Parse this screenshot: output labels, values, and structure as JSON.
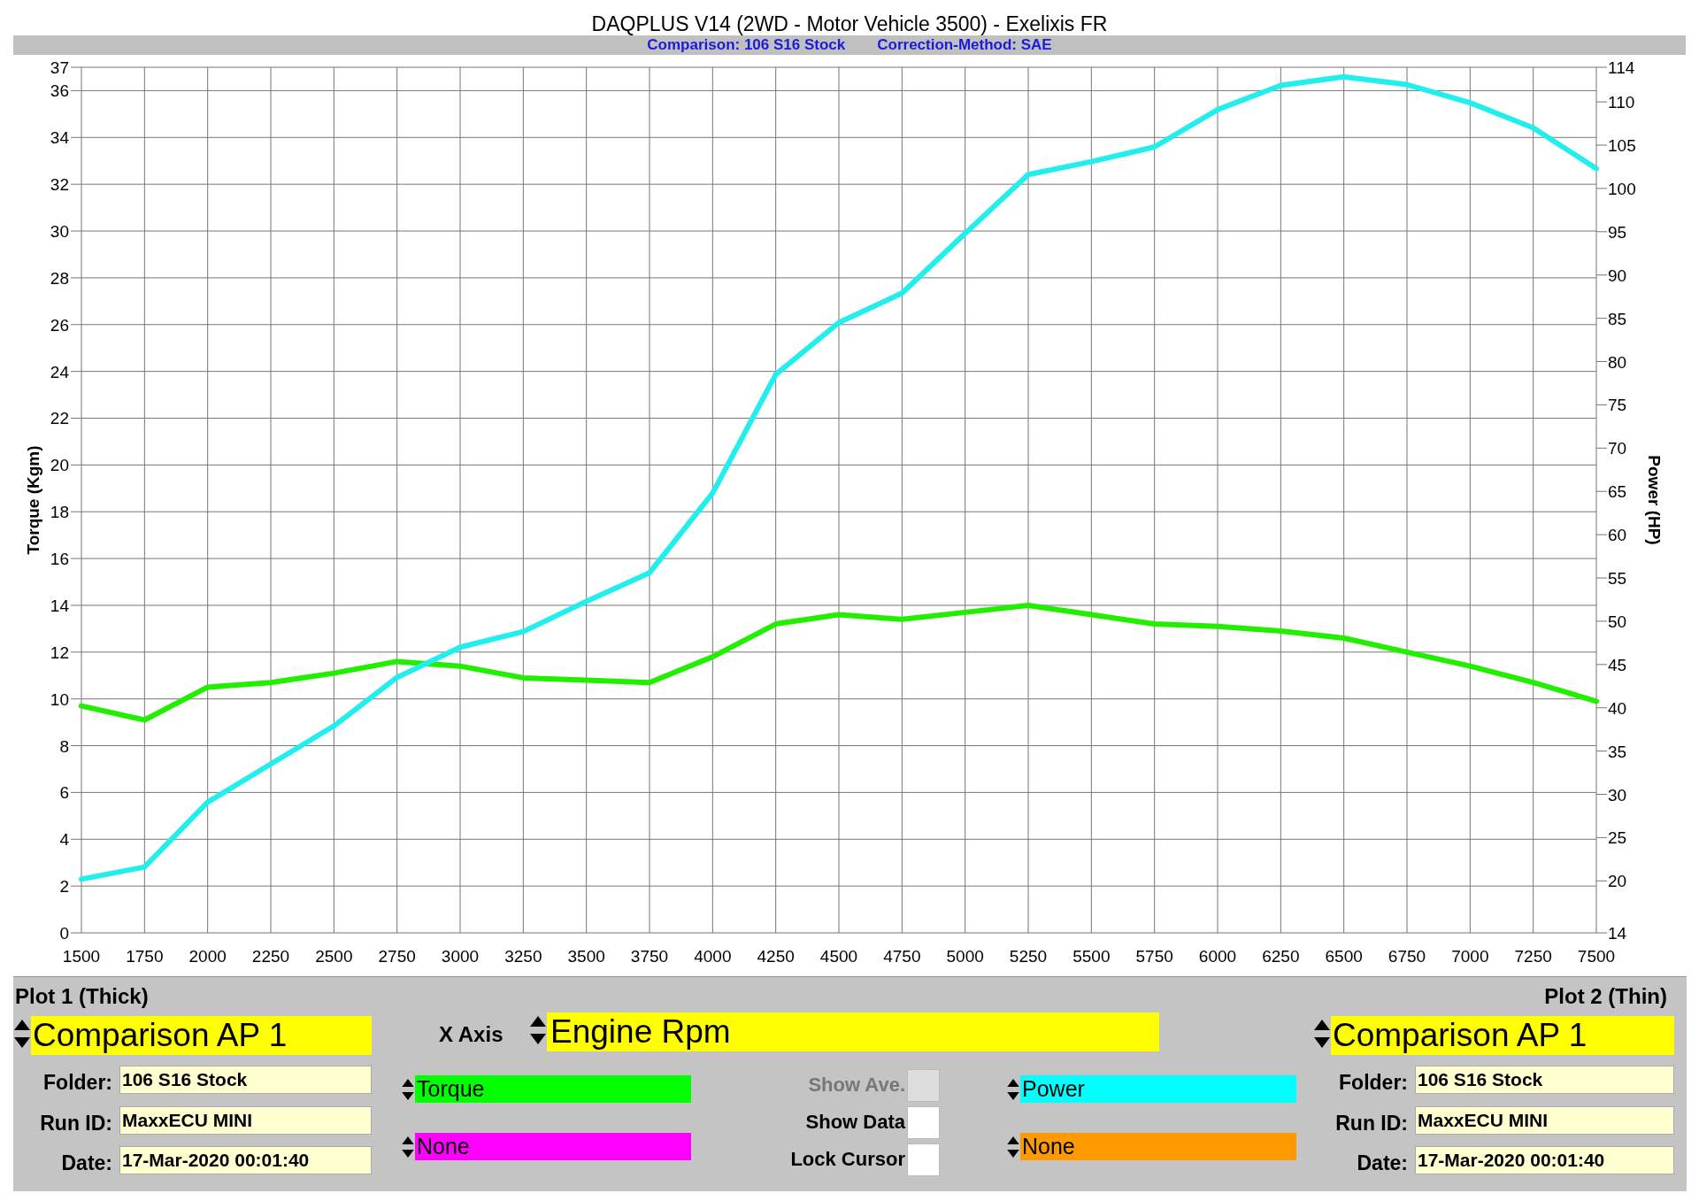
{
  "title": "DAQPLUS V14 (2WD - Motor Vehicle 3500) - Exelixis FR",
  "subtitle": [
    "Comparison: 106 S16 Stock",
    "Correction-Method: SAE"
  ],
  "torque_chart": {
    "chart_data": {
      "type": "line",
      "ylabel": "Torque (Kgm)",
      "grid": true,
      "categories": [
        "1500",
        "1750",
        "2000",
        "2250",
        "2500",
        "2750",
        "3000",
        "3250",
        "3500",
        "3750",
        "4000",
        "4250",
        "4500",
        "4750",
        "5000",
        "5250",
        "5500",
        "5750",
        "6000",
        "6250",
        "6500",
        "6750",
        "7000",
        "7250",
        "7500"
      ],
      "ylim": [
        0,
        37
      ],
      "yticks": [
        0,
        2,
        4,
        6,
        8,
        10,
        12,
        14,
        16,
        18,
        20,
        22,
        24,
        26,
        28,
        30,
        32,
        34,
        36,
        37
      ],
      "series": [
        {
          "color": "#22ee00",
          "values": [
            9.7,
            9.1,
            10.5,
            10.7,
            11.1,
            11.6,
            11.4,
            10.9,
            10.8,
            10.7,
            11.8,
            13.2,
            13.6,
            13.4,
            13.7,
            14.0,
            13.6,
            13.2,
            13.1,
            12.9,
            12.6,
            12.0,
            11.4,
            10.7,
            9.9
          ]
        }
      ]
    }
  },
  "power_chart": {
    "chart_data": {
      "type": "line",
      "ylabel": "Power (HP)",
      "categories": [
        null,
        null,
        null,
        null,
        null,
        null,
        null,
        null,
        null,
        null,
        null,
        null,
        null,
        null,
        null,
        null,
        null,
        null,
        null,
        null,
        null,
        null,
        null,
        null,
        null
      ],
      "ylim": [
        14,
        114
      ],
      "yticks": [
        14,
        20,
        25,
        30,
        35,
        40,
        45,
        50,
        55,
        60,
        65,
        70,
        75,
        80,
        85,
        90,
        95,
        100,
        105,
        110,
        114
      ],
      "series": [
        {
          "color": "#22eeee",
          "values": [
            20.2,
            21.6,
            29.1,
            33.5,
            37.9,
            43.5,
            47.0,
            48.8,
            52.3,
            55.6,
            64.8,
            78.5,
            84.5,
            87.9,
            94.8,
            101.6,
            103.1,
            104.8,
            109.1,
            111.9,
            112.9,
            112.0,
            109.9,
            107.0,
            102.3
          ]
        }
      ]
    }
  },
  "plot1": {
    "heading": "Plot 1 (Thick)",
    "selection": "Comparison AP 1",
    "fields": [
      {
        "label": "Folder:",
        "value": "106 S16 Stock"
      },
      {
        "label": "Run ID:",
        "value": "MaxxECU MINI"
      },
      {
        "label": "Date:",
        "value": "17-Mar-2020 00:01:40"
      }
    ]
  },
  "x_axis": {
    "label": "X Axis",
    "value": "Engine Rpm"
  },
  "channels_left": [
    {
      "value": "Torque",
      "color": "#00ff00"
    },
    {
      "value": "None",
      "color": "#ff00ff"
    }
  ],
  "options": [
    {
      "label": "Show Ave.",
      "checked": false,
      "disabled": true
    },
    {
      "label": "Show Data",
      "checked": false,
      "disabled": false
    },
    {
      "label": "Lock Cursor",
      "checked": false,
      "disabled": false
    }
  ],
  "channels_right": [
    {
      "value": "Power",
      "color": "#00ffff"
    },
    {
      "value": "None",
      "color": "#ff9900"
    }
  ],
  "plot2": {
    "heading": "Plot 2 (Thin)",
    "selection": "Comparison AP 1",
    "fields": [
      {
        "label": "Folder:",
        "value": "106 S16 Stock"
      },
      {
        "label": "Run ID:",
        "value": "MaxxECU MINI"
      },
      {
        "label": "Date:",
        "value": "17-Mar-2020 00:01:40"
      }
    ]
  }
}
